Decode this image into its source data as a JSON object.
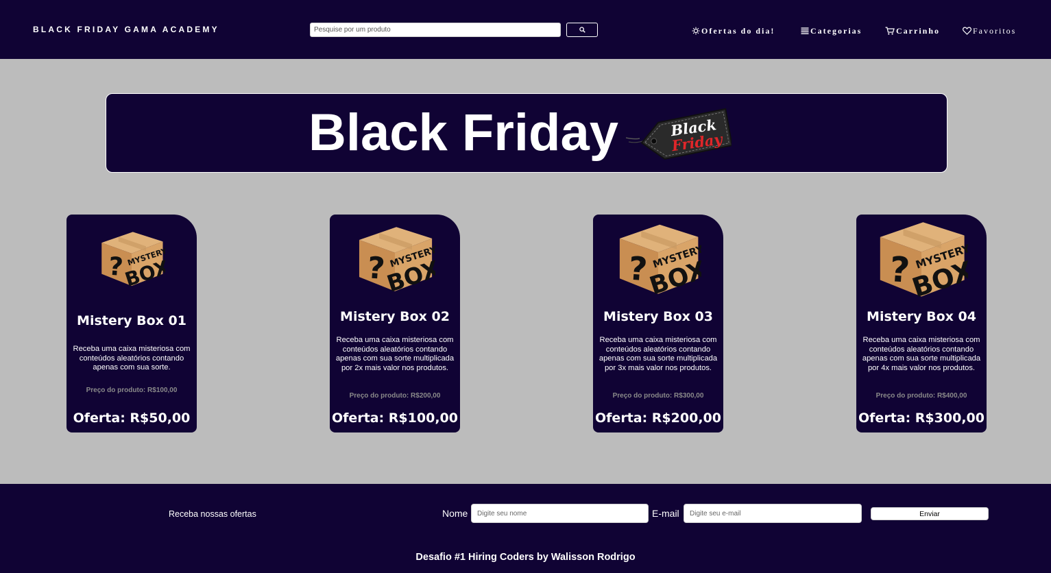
{
  "header": {
    "brand": "BLACK FRIDAY GAMA ACADEMY",
    "search_placeholder": "Pesquise por um produto",
    "search_button_icon": "search-icon",
    "nav": [
      {
        "label": "Ofertas do dia!",
        "icon": "sun-icon"
      },
      {
        "label": "Categorias",
        "icon": "list-icon"
      },
      {
        "label": "Carrinho",
        "icon": "cart-icon"
      },
      {
        "label": "Favoritos",
        "icon": "heart-icon"
      }
    ]
  },
  "banner": {
    "title": "Black Friday",
    "tag_line1": "Black",
    "tag_line2": "Friday"
  },
  "products": [
    {
      "image_text_top": "MYSTERY",
      "image_text_bottom": "BOX",
      "title": "Mistery Box 01",
      "description": "Receba uma caixa misteriosa com conteúdos aleatórios contando apenas com sua sorte.",
      "price": "Preço do produto: R$100,00",
      "offer": "Oferta: R$50,00"
    },
    {
      "image_text_top": "MYSTERY",
      "image_text_bottom": "BOX",
      "title": "Mistery Box 02",
      "description": "Receba uma caixa misteriosa com conteúdos aleatórios contando apenas com sua sorte multiplicada por 2x mais valor nos produtos.",
      "price": "Preço do produto: R$200,00",
      "offer": "Oferta: R$100,00"
    },
    {
      "image_text_top": "MYSTERY",
      "image_text_bottom": "BOX",
      "title": "Mistery Box 03",
      "description": "Receba uma caixa misteriosa com conteúdos aleatórios contando apenas com sua sorte multiplicada por 3x mais valor nos produtos.",
      "price": "Preço do produto: R$300,00",
      "offer": "Oferta: R$200,00"
    },
    {
      "image_text_top": "MYSTERY",
      "image_text_bottom": "BOX",
      "title": "Mistery Box 04",
      "description": "Receba uma caixa misteriosa com conteúdos aleatórios contando apenas com sua sorte multiplicada por 4x mais valor nos produtos.",
      "price": "Preço do produto: R$400,00",
      "offer": "Oferta: R$300,00"
    }
  ],
  "footer": {
    "newsletter_label": "Receba nossas ofertas",
    "name_label": "Nome",
    "name_placeholder": "Digite seu nome",
    "email_label": "E-mail",
    "email_placeholder": "Digite seu e-mail",
    "send_label": "Enviar",
    "credit": "Desafio #1 Hiring Coders by Walisson Rodrigo"
  },
  "colors": {
    "navy": "#100334",
    "page_bg": "#bcbcbc",
    "price_gray": "#8a8a8a",
    "tag_red": "#e0262a"
  }
}
